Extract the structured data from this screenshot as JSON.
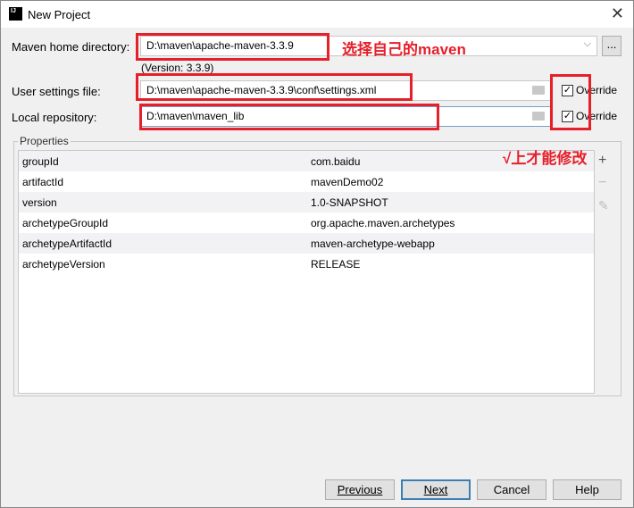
{
  "window": {
    "title": "New Project",
    "app_icon": "IJ"
  },
  "form": {
    "maven_home": {
      "label": "Maven home directory:",
      "value": "D:\\maven\\apache-maven-3.3.9",
      "browse": "..."
    },
    "version": "(Version: 3.3.9)",
    "user_settings": {
      "label": "User settings file:",
      "value": "D:\\maven\\apache-maven-3.3.9\\conf\\settings.xml",
      "override_label": "Override",
      "override_checked": true
    },
    "local_repo": {
      "label": "Local repository:",
      "value": "D:\\maven\\maven_lib",
      "override_label": "Override",
      "override_checked": true
    }
  },
  "properties": {
    "legend": "Properties",
    "rows": [
      {
        "key": "groupId",
        "value": "com.baidu"
      },
      {
        "key": "artifactId",
        "value": "mavenDemo02"
      },
      {
        "key": "version",
        "value": "1.0-SNAPSHOT"
      },
      {
        "key": "archetypeGroupId",
        "value": "org.apache.maven.archetypes"
      },
      {
        "key": "archetypeArtifactId",
        "value": "maven-archetype-webapp"
      },
      {
        "key": "archetypeVersion",
        "value": "RELEASE"
      }
    ]
  },
  "annotations": {
    "maven_note": "选择自己的maven",
    "override_note": "√上才能修改",
    "color": "#e5202a"
  },
  "buttons": {
    "previous": "Previous",
    "next": "Next",
    "cancel": "Cancel",
    "help": "Help"
  }
}
